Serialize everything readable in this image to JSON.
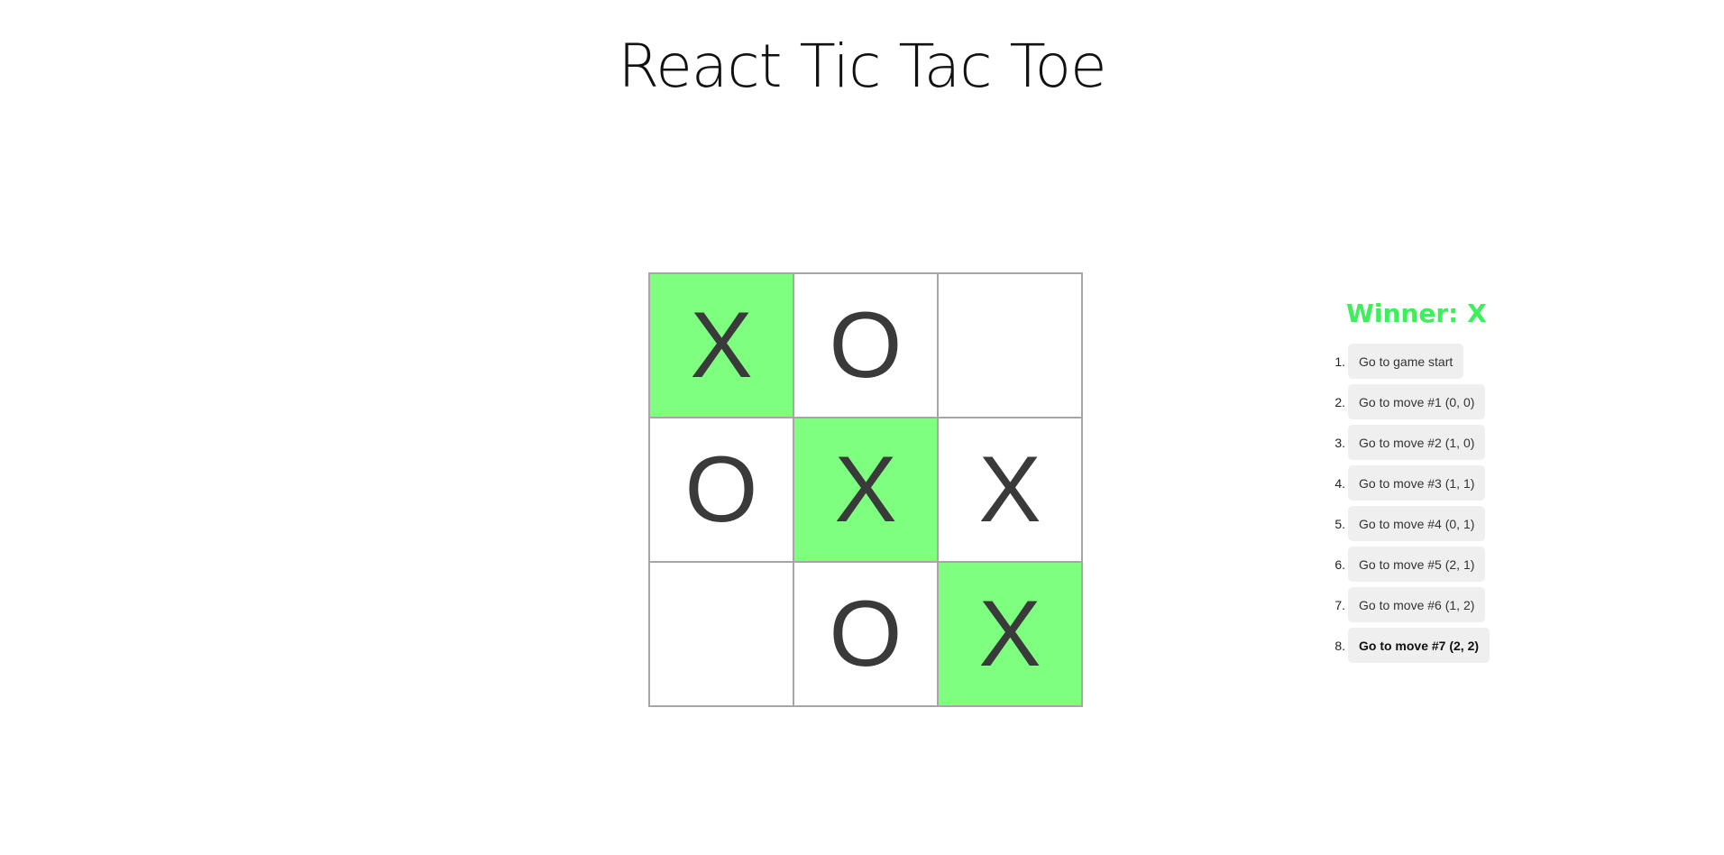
{
  "title": "React Tic Tac Toe",
  "status": "Winner: X",
  "board": {
    "squares": [
      "X",
      "O",
      "",
      "O",
      "X",
      "X",
      "",
      "O",
      "X"
    ],
    "winning_line": [
      0,
      4,
      8
    ]
  },
  "moves": [
    {
      "num": "1.",
      "label": "Go to game start"
    },
    {
      "num": "2.",
      "label": "Go to move #1 (0, 0)"
    },
    {
      "num": "3.",
      "label": "Go to move #2 (1, 0)"
    },
    {
      "num": "4.",
      "label": "Go to move #3 (1, 1)"
    },
    {
      "num": "5.",
      "label": "Go to move #4 (0, 1)"
    },
    {
      "num": "6.",
      "label": "Go to move #5 (2, 1)"
    },
    {
      "num": "7.",
      "label": "Go to move #6 (1, 2)"
    },
    {
      "num": "8.",
      "label": "Go to move #7 (2, 2)"
    }
  ],
  "current_move": 7,
  "colors": {
    "win_highlight": "#7fff7f",
    "status_text": "#3cf05a",
    "mark_text": "#3a3a3a"
  }
}
